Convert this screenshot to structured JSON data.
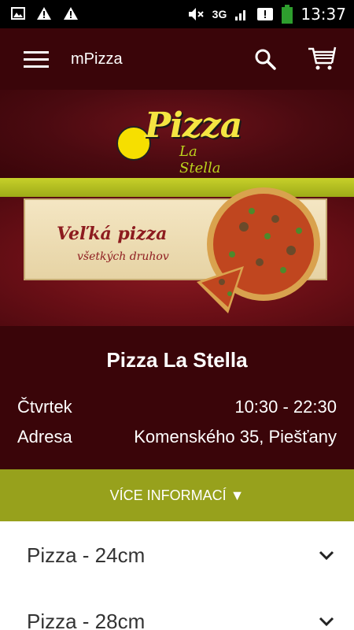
{
  "status_bar": {
    "icons_left": [
      "image-icon",
      "warning-icon",
      "warning-icon"
    ],
    "network": "3G",
    "time": "13:37"
  },
  "app_bar": {
    "title": "mPizza"
  },
  "logo": {
    "main": "Pizza",
    "sub": "La Stella"
  },
  "banner": {
    "title": "Veľká pizza",
    "subtitle": "všetkých druhov"
  },
  "restaurant": {
    "name": "Pizza La Stella",
    "rows": [
      {
        "label": "Čtvrtek",
        "value": "10:30 - 22:30"
      },
      {
        "label": "Adresa",
        "value": "Komenského 35, Piešťany"
      }
    ]
  },
  "more_button": {
    "label": "VÍCE INFORMACÍ ▼"
  },
  "menu_categories": [
    {
      "label": "Pizza - 24cm"
    },
    {
      "label": "Pizza - 28cm"
    }
  ],
  "colors": {
    "primary_dark": "#3a0509",
    "accent_green": "#97a11c",
    "banner_red": "#6a0f16"
  }
}
